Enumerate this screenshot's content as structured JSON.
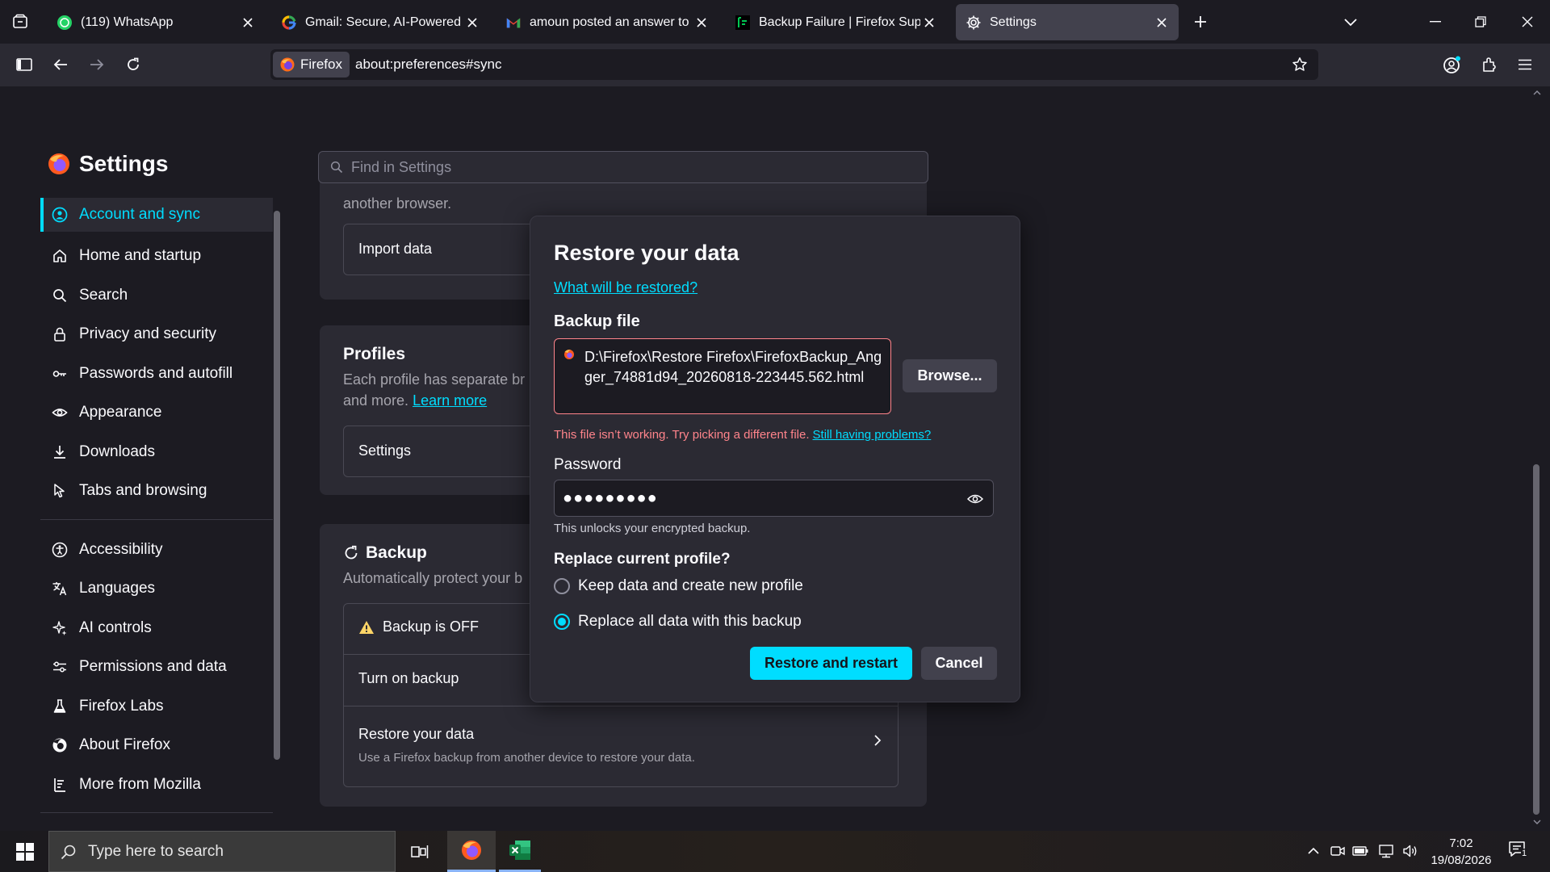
{
  "browser": {
    "tabs": [
      {
        "title": "(119) WhatsApp",
        "icon": "whatsapp-icon",
        "active": false
      },
      {
        "title": "Gmail: Secure, AI-Powered Email",
        "icon": "google-icon",
        "active": false
      },
      {
        "title": "amoun posted an answer to your",
        "icon": "gmail-icon",
        "active": false
      },
      {
        "title": "Backup Failure | Firefox Support",
        "icon": "support-icon",
        "active": false
      },
      {
        "title": "Settings",
        "icon": "gear-icon",
        "active": true
      }
    ],
    "identity_label": "Firefox",
    "url": "about:preferences#sync"
  },
  "settings": {
    "title": "Settings",
    "search_placeholder": "Find in Settings",
    "nav_items": [
      {
        "label": "Account and sync",
        "icon": "account-icon",
        "selected": true
      },
      {
        "label": "Home and startup",
        "icon": "home-icon"
      },
      {
        "label": "Search",
        "icon": "search-icon"
      },
      {
        "label": "Privacy and security",
        "icon": "lock-icon"
      },
      {
        "label": "Passwords and autofill",
        "icon": "key-icon"
      },
      {
        "label": "Appearance",
        "icon": "eye-icon"
      },
      {
        "label": "Downloads",
        "icon": "download-icon"
      },
      {
        "label": "Tabs and browsing",
        "icon": "cursor-icon"
      },
      {
        "label": "Accessibility",
        "icon": "accessibility-icon"
      },
      {
        "label": "Languages",
        "icon": "languages-icon"
      },
      {
        "label": "AI controls",
        "icon": "sparkle-icon"
      },
      {
        "label": "Permissions and data",
        "icon": "sliders-icon"
      },
      {
        "label": "Firefox Labs",
        "icon": "flask-icon"
      },
      {
        "label": "About Firefox",
        "icon": "firefox-icon"
      },
      {
        "label": "More from Mozilla",
        "icon": "mozilla-icon"
      }
    ],
    "import": {
      "desc": "another browser.",
      "button": "Import data"
    },
    "profiles": {
      "title": "Profiles",
      "desc_line1": "Each profile has separate br",
      "desc_line2": "and more.",
      "learn_more": "Learn more",
      "button": "Settings"
    },
    "backup": {
      "title": "Backup",
      "desc": "Automatically protect your b",
      "status": "Backup is OFF",
      "turn_on": "Turn on backup",
      "restore_title": "Restore your data",
      "restore_desc": "Use a Firefox backup from another device to restore your data."
    }
  },
  "dialog": {
    "title": "Restore your data",
    "what_link": "What will be restored?",
    "backup_file_label": "Backup file",
    "file_path": "D:\\Firefox\\Restore Firefox\\FirefoxBackup_Angger_74881d94_20260818-223445.562.html",
    "browse": "Browse...",
    "error": "This file isn’t working. Try picking a different file.",
    "error_link": "Still having problems?",
    "password_label": "Password",
    "password_mask": "●●●●●●●●●",
    "password_hint": "This unlocks your encrypted backup.",
    "replace_label": "Replace current profile?",
    "option_keep": "Keep data and create new profile",
    "option_replace": "Replace all data with this backup",
    "selected_option": "replace",
    "restore_button": "Restore and restart",
    "cancel_button": "Cancel"
  },
  "taskbar": {
    "search_placeholder": "Type here to search",
    "time": "7:02",
    "date": "19/08/2026",
    "notification_count": "1"
  },
  "colors": {
    "accent": "#00ddff",
    "error": "#ff848b",
    "surface": "#2b2a33",
    "background": "#1c1b22"
  }
}
